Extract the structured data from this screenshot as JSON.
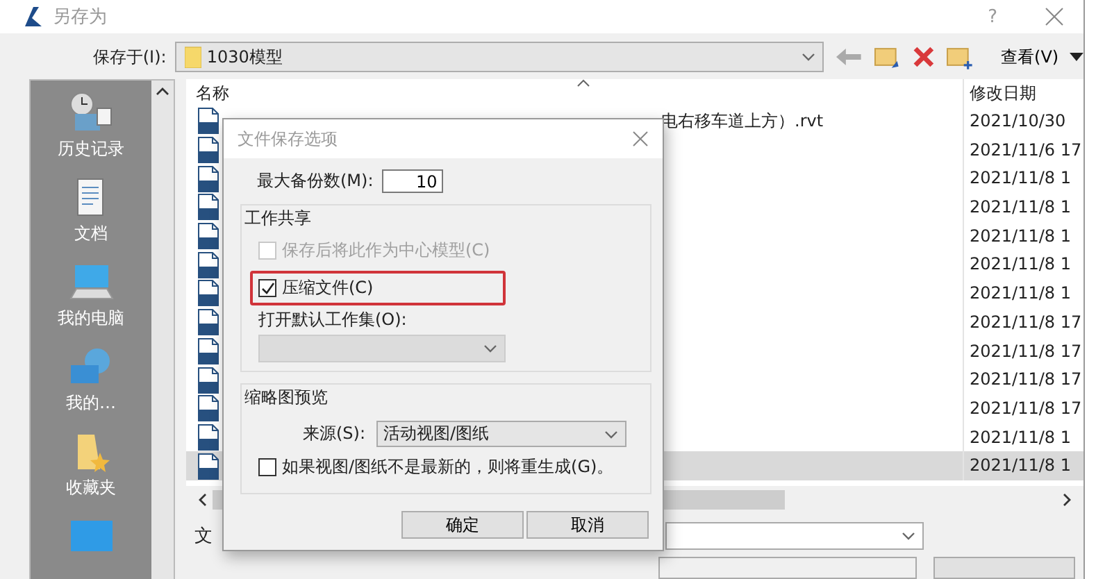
{
  "window": {
    "title": "另存为",
    "help": "?"
  },
  "save_in": {
    "label": "保存于(I):",
    "folder": "1030模型"
  },
  "toolbar": {
    "view_label": "查看(V)"
  },
  "places": [
    {
      "label": "历史记录",
      "kind": "history"
    },
    {
      "label": "文档",
      "kind": "documents"
    },
    {
      "label": "我的电脑",
      "kind": "computer"
    },
    {
      "label": "我的…",
      "kind": "network"
    },
    {
      "label": "收藏夹",
      "kind": "favorites"
    },
    {
      "kind": "desktop"
    }
  ],
  "file_list": {
    "columns": [
      "名称",
      "修改日期"
    ],
    "rows": [
      {
        "name": "电右移车道上方）.rvt",
        "modified": "2021/10/30",
        "selected": false
      },
      {
        "modified": "2021/11/6 17",
        "selected": false
      },
      {
        "modified": "2021/11/8 1",
        "selected": false
      },
      {
        "modified": "2021/11/8 1",
        "selected": false
      },
      {
        "modified": "2021/11/8 1",
        "selected": false
      },
      {
        "modified": "2021/11/8 1",
        "selected": false
      },
      {
        "modified": "2021/11/8 1",
        "selected": false
      },
      {
        "modified": "2021/11/8 17",
        "selected": false
      },
      {
        "modified": "2021/11/8 17",
        "selected": false
      },
      {
        "modified": "2021/11/8 17",
        "selected": false
      },
      {
        "modified": "2021/11/8 17",
        "selected": false
      },
      {
        "modified": "2021/11/8 1",
        "selected": false
      },
      {
        "modified": "2021/11/8 1",
        "selected": true
      }
    ]
  },
  "file_name_label": "文",
  "dialog": {
    "title": "文件保存选项",
    "max_backups": {
      "label": "最大备份数(M):",
      "value": "10"
    },
    "worksharing": {
      "title": "工作共享",
      "options": [
        {
          "label": "保存后将此作为中心模型(C)",
          "checked": false,
          "disabled": true,
          "highlighted": false
        },
        {
          "label": "压缩文件(C)",
          "checked": true,
          "disabled": false,
          "highlighted": true
        }
      ],
      "workset_label": "打开默认工作集(O):",
      "workset_disabled": true
    },
    "thumbnail": {
      "title": "缩略图预览",
      "source_label": "来源(S):",
      "source_value": "活动视图/图纸",
      "regenerate": {
        "label": "如果视图/图纸不是最新的，则将重生成(G)。",
        "checked": false
      }
    },
    "buttons": [
      "确定",
      "取消"
    ]
  }
}
